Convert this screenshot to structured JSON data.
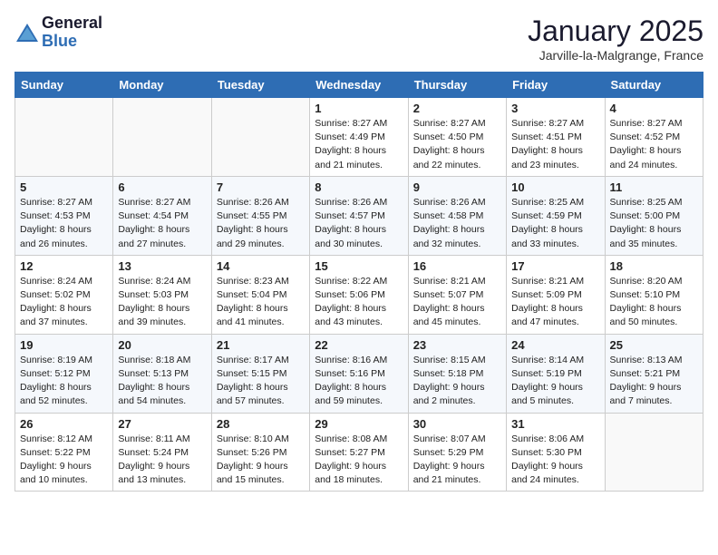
{
  "logo": {
    "general": "General",
    "blue": "Blue"
  },
  "header": {
    "month": "January 2025",
    "location": "Jarville-la-Malgrange, France"
  },
  "weekdays": [
    "Sunday",
    "Monday",
    "Tuesday",
    "Wednesday",
    "Thursday",
    "Friday",
    "Saturday"
  ],
  "weeks": [
    [
      {
        "day": "",
        "info": ""
      },
      {
        "day": "",
        "info": ""
      },
      {
        "day": "",
        "info": ""
      },
      {
        "day": "1",
        "info": "Sunrise: 8:27 AM\nSunset: 4:49 PM\nDaylight: 8 hours\nand 21 minutes."
      },
      {
        "day": "2",
        "info": "Sunrise: 8:27 AM\nSunset: 4:50 PM\nDaylight: 8 hours\nand 22 minutes."
      },
      {
        "day": "3",
        "info": "Sunrise: 8:27 AM\nSunset: 4:51 PM\nDaylight: 8 hours\nand 23 minutes."
      },
      {
        "day": "4",
        "info": "Sunrise: 8:27 AM\nSunset: 4:52 PM\nDaylight: 8 hours\nand 24 minutes."
      }
    ],
    [
      {
        "day": "5",
        "info": "Sunrise: 8:27 AM\nSunset: 4:53 PM\nDaylight: 8 hours\nand 26 minutes."
      },
      {
        "day": "6",
        "info": "Sunrise: 8:27 AM\nSunset: 4:54 PM\nDaylight: 8 hours\nand 27 minutes."
      },
      {
        "day": "7",
        "info": "Sunrise: 8:26 AM\nSunset: 4:55 PM\nDaylight: 8 hours\nand 29 minutes."
      },
      {
        "day": "8",
        "info": "Sunrise: 8:26 AM\nSunset: 4:57 PM\nDaylight: 8 hours\nand 30 minutes."
      },
      {
        "day": "9",
        "info": "Sunrise: 8:26 AM\nSunset: 4:58 PM\nDaylight: 8 hours\nand 32 minutes."
      },
      {
        "day": "10",
        "info": "Sunrise: 8:25 AM\nSunset: 4:59 PM\nDaylight: 8 hours\nand 33 minutes."
      },
      {
        "day": "11",
        "info": "Sunrise: 8:25 AM\nSunset: 5:00 PM\nDaylight: 8 hours\nand 35 minutes."
      }
    ],
    [
      {
        "day": "12",
        "info": "Sunrise: 8:24 AM\nSunset: 5:02 PM\nDaylight: 8 hours\nand 37 minutes."
      },
      {
        "day": "13",
        "info": "Sunrise: 8:24 AM\nSunset: 5:03 PM\nDaylight: 8 hours\nand 39 minutes."
      },
      {
        "day": "14",
        "info": "Sunrise: 8:23 AM\nSunset: 5:04 PM\nDaylight: 8 hours\nand 41 minutes."
      },
      {
        "day": "15",
        "info": "Sunrise: 8:22 AM\nSunset: 5:06 PM\nDaylight: 8 hours\nand 43 minutes."
      },
      {
        "day": "16",
        "info": "Sunrise: 8:21 AM\nSunset: 5:07 PM\nDaylight: 8 hours\nand 45 minutes."
      },
      {
        "day": "17",
        "info": "Sunrise: 8:21 AM\nSunset: 5:09 PM\nDaylight: 8 hours\nand 47 minutes."
      },
      {
        "day": "18",
        "info": "Sunrise: 8:20 AM\nSunset: 5:10 PM\nDaylight: 8 hours\nand 50 minutes."
      }
    ],
    [
      {
        "day": "19",
        "info": "Sunrise: 8:19 AM\nSunset: 5:12 PM\nDaylight: 8 hours\nand 52 minutes."
      },
      {
        "day": "20",
        "info": "Sunrise: 8:18 AM\nSunset: 5:13 PM\nDaylight: 8 hours\nand 54 minutes."
      },
      {
        "day": "21",
        "info": "Sunrise: 8:17 AM\nSunset: 5:15 PM\nDaylight: 8 hours\nand 57 minutes."
      },
      {
        "day": "22",
        "info": "Sunrise: 8:16 AM\nSunset: 5:16 PM\nDaylight: 8 hours\nand 59 minutes."
      },
      {
        "day": "23",
        "info": "Sunrise: 8:15 AM\nSunset: 5:18 PM\nDaylight: 9 hours\nand 2 minutes."
      },
      {
        "day": "24",
        "info": "Sunrise: 8:14 AM\nSunset: 5:19 PM\nDaylight: 9 hours\nand 5 minutes."
      },
      {
        "day": "25",
        "info": "Sunrise: 8:13 AM\nSunset: 5:21 PM\nDaylight: 9 hours\nand 7 minutes."
      }
    ],
    [
      {
        "day": "26",
        "info": "Sunrise: 8:12 AM\nSunset: 5:22 PM\nDaylight: 9 hours\nand 10 minutes."
      },
      {
        "day": "27",
        "info": "Sunrise: 8:11 AM\nSunset: 5:24 PM\nDaylight: 9 hours\nand 13 minutes."
      },
      {
        "day": "28",
        "info": "Sunrise: 8:10 AM\nSunset: 5:26 PM\nDaylight: 9 hours\nand 15 minutes."
      },
      {
        "day": "29",
        "info": "Sunrise: 8:08 AM\nSunset: 5:27 PM\nDaylight: 9 hours\nand 18 minutes."
      },
      {
        "day": "30",
        "info": "Sunrise: 8:07 AM\nSunset: 5:29 PM\nDaylight: 9 hours\nand 21 minutes."
      },
      {
        "day": "31",
        "info": "Sunrise: 8:06 AM\nSunset: 5:30 PM\nDaylight: 9 hours\nand 24 minutes."
      },
      {
        "day": "",
        "info": ""
      }
    ]
  ]
}
